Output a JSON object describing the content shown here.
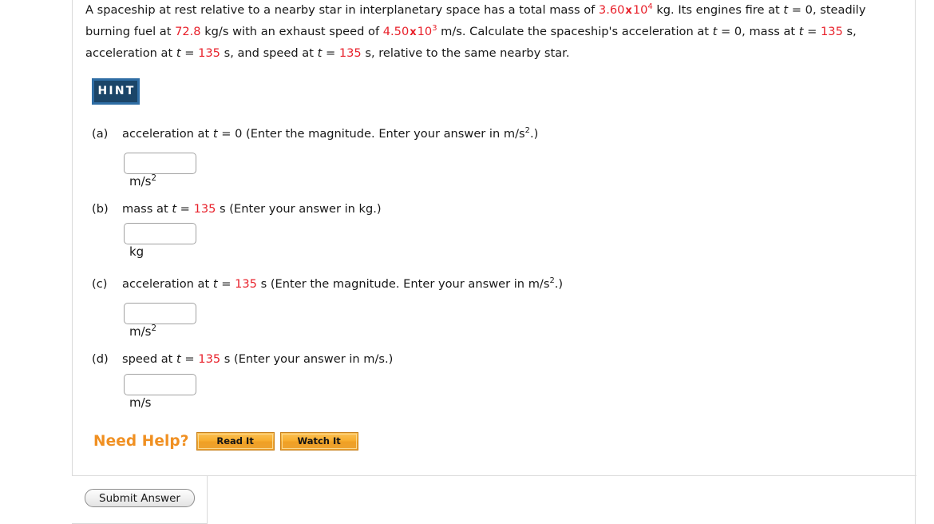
{
  "problem": {
    "line1_a": "A spaceship at rest relative to a nearby star in interplanetary space has a total mass of ",
    "mass_value": "3.60",
    "mult": "x",
    "mass_exp": "4",
    "line1_b": " kg. Its engines fire at ",
    "t_var": "t",
    "eq": " = 0,",
    "line2_a": "steadily burning fuel at ",
    "burn_rate": "72.8",
    "line2_b": " kg/s with an exhaust speed of ",
    "exhaust_value": "4.50",
    "exhaust_exp": "3",
    "line2_c": " m/s. Calculate the spaceship's acceleration at ",
    "line2_d": " = 0, mass",
    "line3_a": "at ",
    "line3_eq": " = ",
    "time_value": "135",
    "line3_b": " s, acceleration at ",
    "line3_c": " s, and speed at ",
    "line3_d": " s, relative to the same nearby star."
  },
  "hint": {
    "label": "HINT"
  },
  "parts": [
    {
      "label": "(a)",
      "prompt_pre": "acceleration at ",
      "var": "t",
      "prompt_eq": " = 0 (Enter the magnitude. Enter your answer in m/s",
      "prompt_exp": "2",
      "prompt_post": ".)",
      "value": "",
      "unit_base": "m/s",
      "unit_exp": "2"
    },
    {
      "label": "(b)",
      "prompt_pre": "mass at ",
      "var": "t",
      "prompt_eq": " = ",
      "prompt_time": "135",
      "prompt_post": " s (Enter your answer in kg.)",
      "value": "",
      "unit_base": "kg",
      "unit_exp": ""
    },
    {
      "label": "(c)",
      "prompt_pre": "acceleration at ",
      "var": "t",
      "prompt_eq": " = ",
      "prompt_time": "135",
      "prompt_mid": " s (Enter the magnitude. Enter your answer in m/s",
      "prompt_exp": "2",
      "prompt_post": ".)",
      "value": "",
      "unit_base": "m/s",
      "unit_exp": "2"
    },
    {
      "label": "(d)",
      "prompt_pre": "speed at ",
      "var": "t",
      "prompt_eq": " = ",
      "prompt_time": "135",
      "prompt_post": " s (Enter your answer in m/s.)",
      "value": "",
      "unit_base": "m/s",
      "unit_exp": ""
    }
  ],
  "need_help": {
    "label": "Need Help?",
    "read_it": "Read It",
    "watch_it": "Watch It"
  },
  "submit": {
    "label": "Submit Answer"
  },
  "colors": {
    "red": "#e8202a",
    "orange": "#f09022",
    "hint_bg": "#1b4568",
    "hint_border": "#2f6da4"
  }
}
